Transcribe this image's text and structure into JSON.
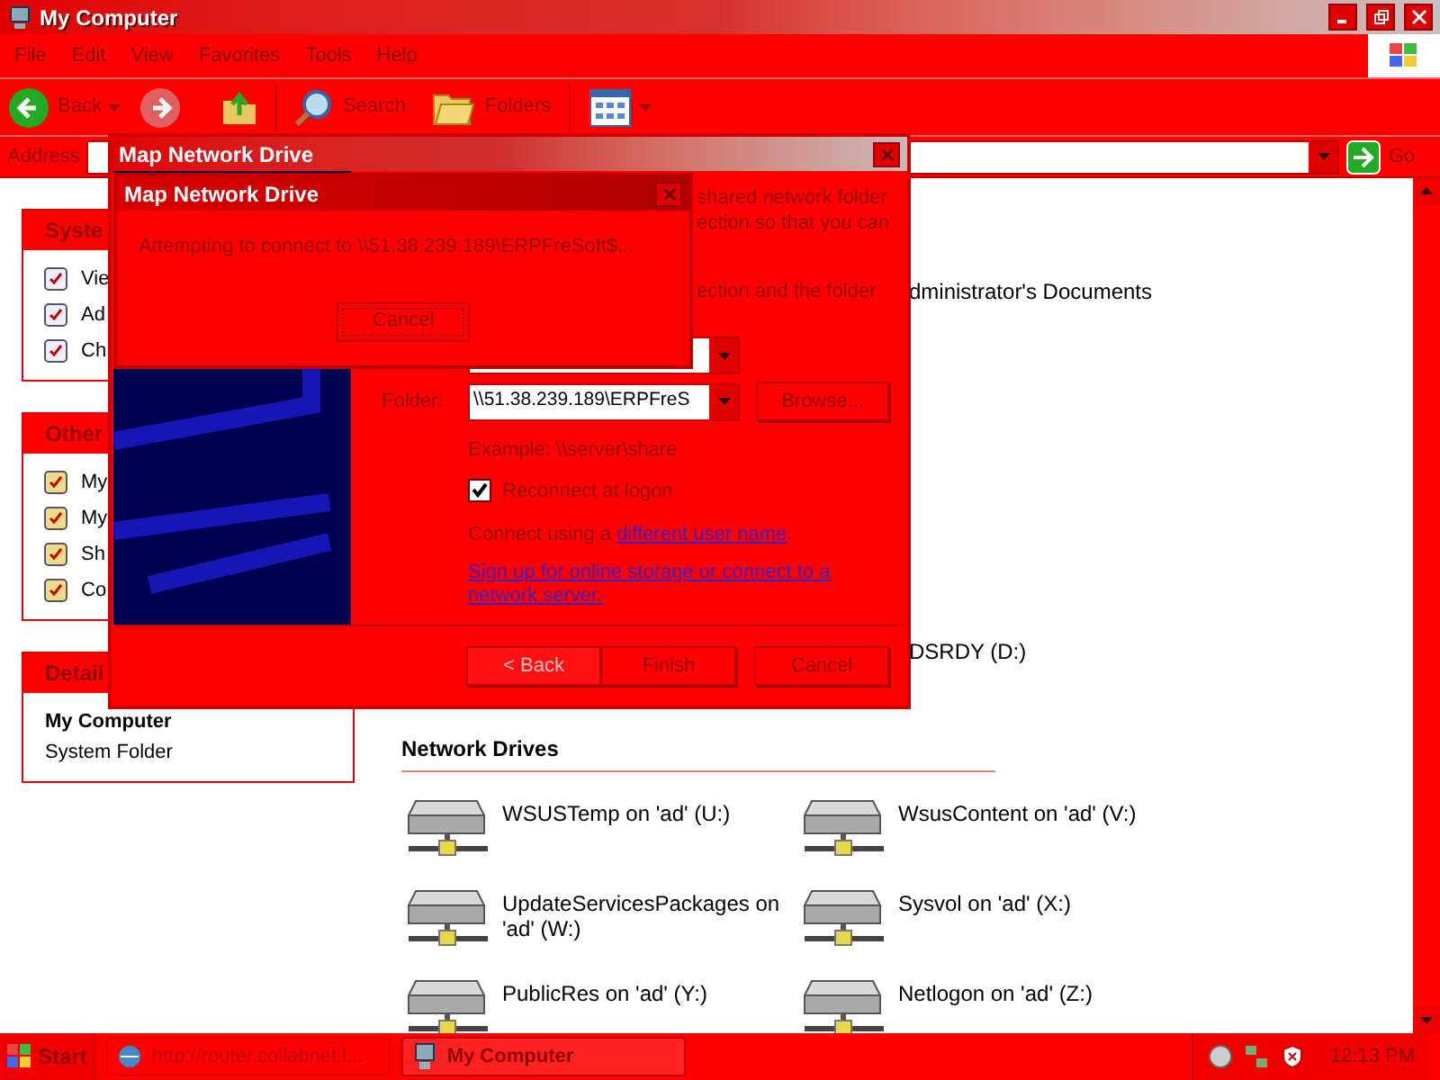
{
  "window": {
    "title": "My Computer"
  },
  "menu": [
    "File",
    "Edit",
    "View",
    "Favorites",
    "Tools",
    "Help"
  ],
  "toolbar": {
    "back": "Back",
    "search": "Search",
    "folders": "Folders",
    "forward_disabled": true
  },
  "address": {
    "label": "Address",
    "go": "Go"
  },
  "sidebar": {
    "panels": [
      {
        "title": "Syste",
        "items": [
          "Vie",
          "Ad",
          "Ch"
        ]
      },
      {
        "title": "Other",
        "items": [
          "My",
          "My",
          "Sh",
          "Co"
        ]
      },
      {
        "title": "Detail",
        "name": "My Computer",
        "type": "System Folder"
      }
    ]
  },
  "content": {
    "top_items": [
      "dministrator's Documents",
      "DSRDY (D:)"
    ],
    "section": "Network Drives",
    "drives": [
      {
        "label": "WSUSTemp on 'ad' (U:)"
      },
      {
        "label": "WsusContent on 'ad' (V:)"
      },
      {
        "label": "UpdateServicesPackages on 'ad' (W:)"
      },
      {
        "label": "Sysvol on 'ad' (X:)"
      },
      {
        "label": "PublicRes on 'ad' (Y:)"
      },
      {
        "label": "Netlogon on 'ad' (Z:)"
      }
    ]
  },
  "wizard": {
    "title": "Map Network Drive",
    "intro": [
      "shared network folder",
      "ection so that you can",
      "ection and the folder"
    ],
    "folder_label": "Folder:",
    "folder_value": "\\\\51.38.239.189\\ERPFreS",
    "browse": "Browse...",
    "example": "Example: \\\\server\\share",
    "reconnect": {
      "label": "Reconnect at logon",
      "checked": true
    },
    "connect_text": "Connect using a",
    "connect_link": "different user name",
    "connect_end": ".",
    "signup_link": "Sign up for online storage or connect to a network server.",
    "buttons": [
      {
        "label": "< Back",
        "disabled": true
      },
      {
        "label": "Finish",
        "disabled": false
      },
      {
        "label": "Cancel",
        "disabled": false
      }
    ]
  },
  "progress": {
    "title": "Map Network Drive",
    "message": "Attempting to connect to \\\\51.38.239.189\\ERPFreSoft$...",
    "button": "Cancel"
  },
  "taskbar": {
    "start": "Start",
    "tasks": [
      {
        "label": "http://router.collabnet.l...",
        "selected": false,
        "kind": "browser"
      },
      {
        "label": "My Computer",
        "selected": true,
        "kind": "computer"
      }
    ],
    "clock": "12:13 PM"
  }
}
